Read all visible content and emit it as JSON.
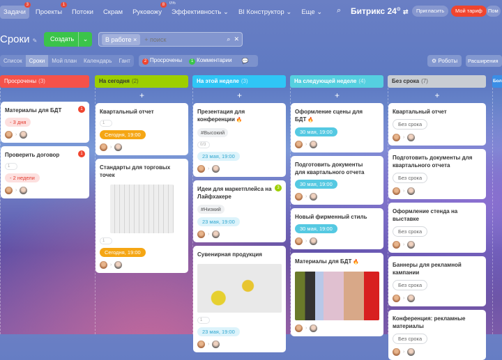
{
  "topnav": [
    {
      "label": "Задачи",
      "badge": "3",
      "active": true
    },
    {
      "label": "Проекты",
      "badge": "1"
    },
    {
      "label": "Потоки"
    },
    {
      "label": "Скрам"
    },
    {
      "label": "Руковожу",
      "badge": "8"
    },
    {
      "label": "Эффективность ⌄",
      "pct": "0%"
    },
    {
      "label": "BI Конструктор ⌄"
    },
    {
      "label": "Еще ⌄"
    }
  ],
  "header": {
    "logo": "Битрикс 24",
    "invite": "Пригласить",
    "tariff": "Мой тариф",
    "help": "Пом"
  },
  "page": {
    "title": "Сроки",
    "create": "Создать",
    "filter_chip": "В работе",
    "search_placeholder": "+ поиск"
  },
  "views": [
    "Список",
    "Сроки",
    "Мой план",
    "Календарь",
    "Гант"
  ],
  "counters": {
    "overdue_count": "2",
    "overdue": "Просрочены",
    "comments_count": "1",
    "comments": "Комментарии"
  },
  "right_buttons": {
    "robots": "Роботы",
    "extensions": "Расширения"
  },
  "colors": {
    "overdue": "#f5524a",
    "today": "#9dcf00",
    "week": "#2fc6f6",
    "next": "#55d0e0",
    "none": "#c8cdd3",
    "more": "#3a8ee6"
  },
  "columns": [
    {
      "title": "Просрочены",
      "count": "(3)",
      "kind": "overdue",
      "cards": [
        {
          "title": "Материалы для БДТ",
          "badge": "1",
          "deadline": "- 3 дня"
        },
        {
          "title": "Проверить договор",
          "badge": "1",
          "files": "1",
          "deadline": "- 2 недели"
        }
      ]
    },
    {
      "title": "На сегодня",
      "count": "(2)",
      "kind": "today",
      "cards": [
        {
          "title": "Квартальный отчет",
          "files": "1",
          "deadline": "Сегодня, 19:00"
        },
        {
          "title": "Стандарты для торговых точек",
          "image": "building",
          "files": "1",
          "deadline": "Сегодня, 19:00"
        }
      ]
    },
    {
      "title": "На этой неделе",
      "count": "(3)",
      "kind": "week",
      "cards": [
        {
          "title": "Презентация для конференции",
          "fire": true,
          "tag": "#Высокий",
          "files": "0/3",
          "deadline": "23 мая, 19:00"
        },
        {
          "title": "Идеи для маркетплейса на Лайфхакере",
          "badge": "3",
          "tag": "#Низкий",
          "deadline": "23 мая, 19:00"
        },
        {
          "title": "Сувенирная продукция",
          "image": "merch",
          "files": "1",
          "deadline": "23 мая, 19:00"
        }
      ]
    },
    {
      "title": "На следующей неделе",
      "count": "(4)",
      "kind": "next",
      "cards": [
        {
          "title": "Оформление сцены для БДТ",
          "fire": true,
          "deadline": "30 мая, 19:00"
        },
        {
          "title": "Подготовить документы для квартального отчета",
          "deadline": "30 мая, 19:00"
        },
        {
          "title": "Новый фирменный стиль",
          "deadline": "30 мая, 19:00"
        },
        {
          "title": "Материалы для БДТ",
          "fire": true,
          "image": "fabric"
        }
      ]
    },
    {
      "title": "Без срока",
      "count": "(7)",
      "kind": "none",
      "cards": [
        {
          "title": "Квартальный отчет",
          "deadline": "Без срока"
        },
        {
          "title": "Подготовить документы для квартального отчета",
          "deadline": "Без срока"
        },
        {
          "title": "Оформление стенда на выставке",
          "deadline": "Без срока"
        },
        {
          "title": "Баннеры для рекламной кампании",
          "deadline": "Без срока"
        },
        {
          "title": "Конференция: рекламные материалы",
          "deadline": "Без срока"
        }
      ]
    },
    {
      "title": "Бол",
      "kind": "more",
      "cards": []
    }
  ]
}
